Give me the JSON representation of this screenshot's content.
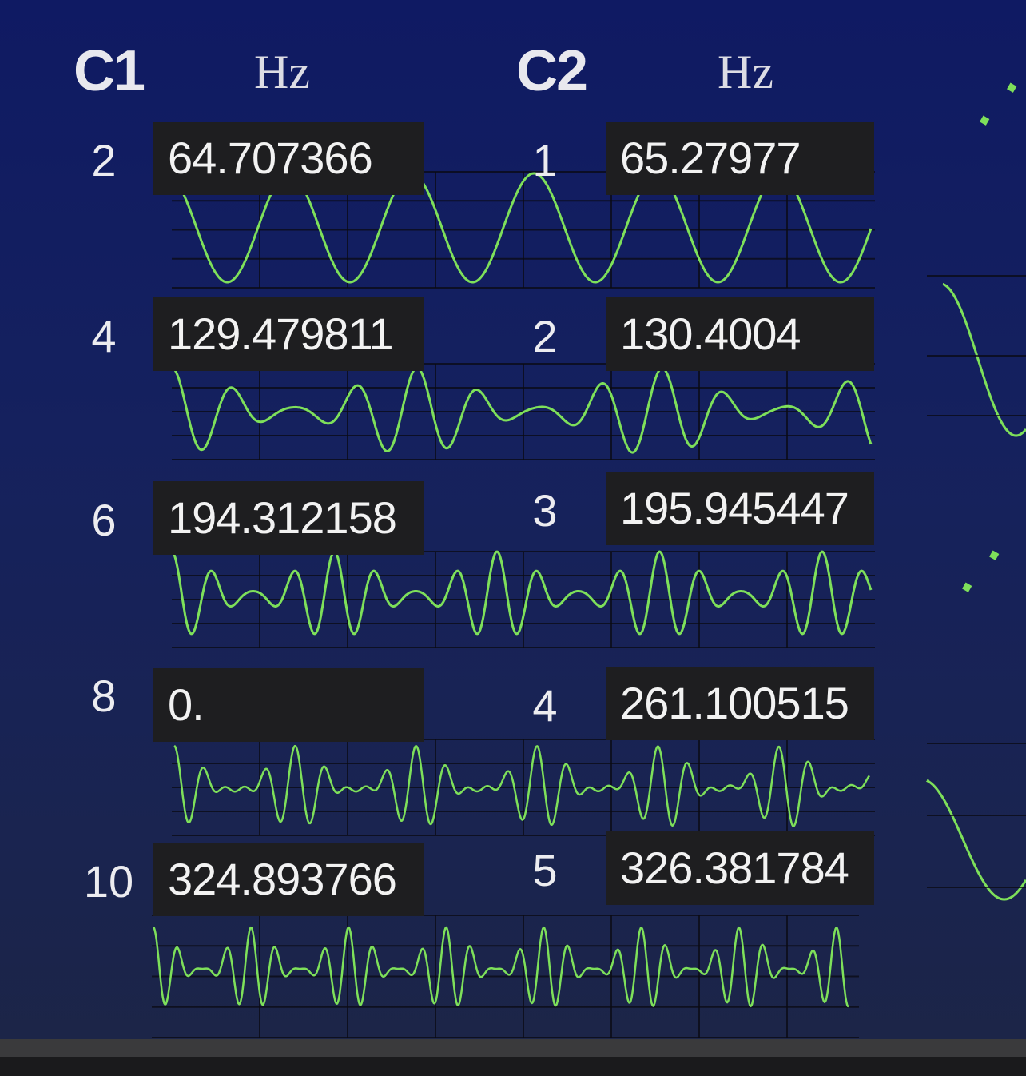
{
  "columns": [
    {
      "label": "C1",
      "unit": "Hz",
      "rows": [
        {
          "index": "2",
          "freq": "64.707366"
        },
        {
          "index": "4",
          "freq": "129.479811"
        },
        {
          "index": "6",
          "freq": "194.312158"
        },
        {
          "index": "8",
          "freq": "0."
        },
        {
          "index": "10",
          "freq": "324.893766"
        }
      ]
    },
    {
      "label": "C2",
      "unit": "Hz",
      "rows": [
        {
          "index": "1",
          "freq": "65.27977"
        },
        {
          "index": "2",
          "freq": "130.4004"
        },
        {
          "index": "3",
          "freq": "195.945447"
        },
        {
          "index": "4",
          "freq": "261.100515"
        },
        {
          "index": "5",
          "freq": "326.381784"
        }
      ]
    }
  ],
  "colors": {
    "wave": "#7ee05a",
    "grid": "#0a0a12",
    "label_bg": "#1e1e20",
    "text": "#ececf0"
  }
}
